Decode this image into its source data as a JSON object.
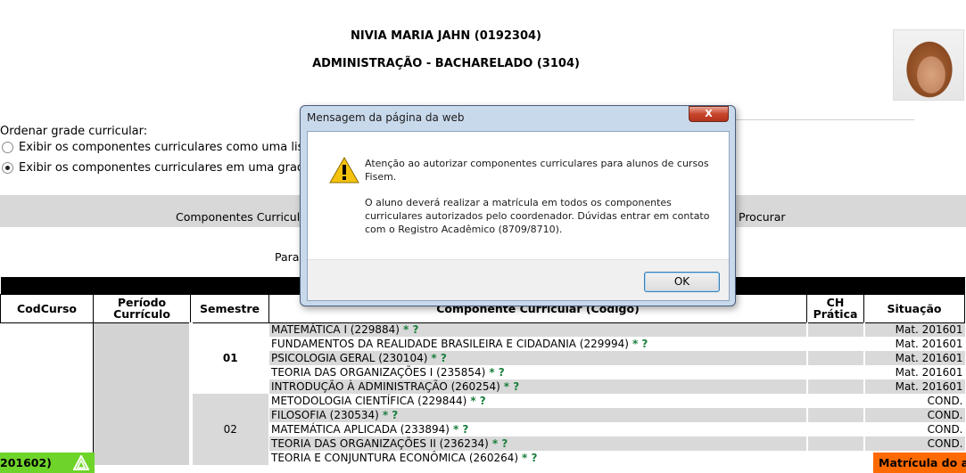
{
  "student": {
    "name": "NIVIA MARIA JAHN (0192304)",
    "course": "ADMINISTRAÇÃO - BACHARELADO (3104)"
  },
  "sort": {
    "label": "Ordenar grade curricular:",
    "options": [
      {
        "label": "Exibir os componentes curriculares como uma lista",
        "checked": false
      },
      {
        "label": "Exibir os componentes curriculares em uma grade",
        "checked": true
      }
    ]
  },
  "tabs": {
    "left": "Componentes Curricula",
    "right": "Procurar"
  },
  "para_text": "Para",
  "table": {
    "headers": {
      "cod": "CodCurso",
      "periodo": "Período Currículo",
      "semestre": "Semestre",
      "componente": "Componente Curricular (Código)",
      "ch": "CH Prática",
      "situacao": "Situação"
    },
    "semesters": [
      {
        "label": "01",
        "rows": [
          {
            "comp": "MATEMÁTICA I (229884)",
            "marks": "* ?",
            "sit": "Mat. 201601"
          },
          {
            "comp": "FUNDAMENTOS DA REALIDADE BRASILEIRA E CIDADANIA (229994)",
            "marks": "* ?",
            "sit": "Mat. 201601"
          },
          {
            "comp": "PSICOLOGIA GERAL (230104)",
            "marks": "* ?",
            "sit": "Mat. 201601"
          },
          {
            "comp": "TEORIA DAS ORGANIZAÇÕES I (235854)",
            "marks": "* ?",
            "sit": "Mat. 201601"
          },
          {
            "comp": "INTRODUÇÃO À ADMINISTRAÇÃO (260254)",
            "marks": "* ?",
            "sit": "Mat. 201601"
          }
        ]
      },
      {
        "label": "02",
        "rows": [
          {
            "comp": "METODOLOGIA CIENTÍFICA (229844)",
            "marks": "* ?",
            "sit": "COND."
          },
          {
            "comp": "FILOSOFIA (230534)",
            "marks": "* ?",
            "sit": "COND."
          },
          {
            "comp": "MATEMÁTICA APLICADA (233894)",
            "marks": "* ?",
            "sit": "COND."
          },
          {
            "comp": "TEORIA DAS ORGANIZAÇÕES II (236234)",
            "marks": "* ?",
            "sit": "COND."
          },
          {
            "comp": "TEORIA E CONJUNTURA ECONÔMICA (260264)",
            "marks": "* ?",
            "sit": ""
          }
        ]
      }
    ]
  },
  "dialog": {
    "title": "Mensagem da página da web",
    "close_label": "X",
    "message_1": "Atenção ao autorizar componentes curriculares para alunos de cursos Fisem.",
    "message_2": "O aluno deverá realizar a matrícula em todos os componentes curriculares autorizados pelo coordenador. Dúvidas entrar em contato com o Registro Acadêmico (8709/8710).",
    "ok_label": "OK"
  },
  "status_left": "201602)",
  "status_right": "Matrícula do al",
  "colors": {
    "status_green": "#6fd42a",
    "status_orange": "#ff6a00",
    "dialog_frame": "#c9d9ec"
  }
}
